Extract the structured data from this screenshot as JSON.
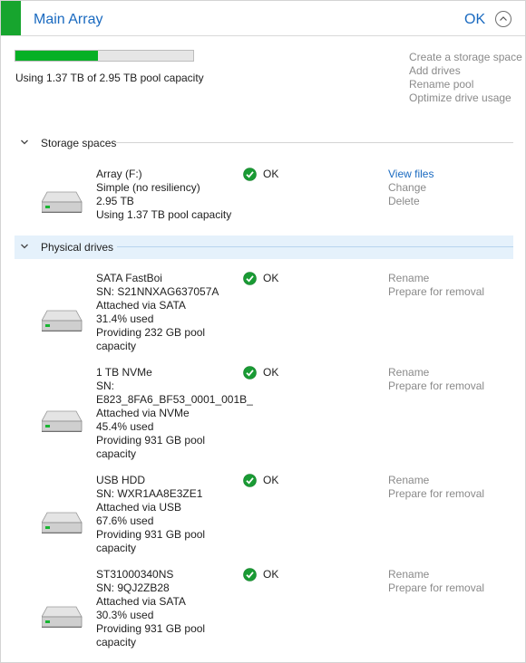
{
  "pool": {
    "title": "Main Array",
    "status": "OK",
    "usage_fraction": 0.464,
    "usage_text": "Using 1.37 TB of 2.95 TB pool capacity",
    "actions": [
      "Create a storage space",
      "Add drives",
      "Rename pool",
      "Optimize drive usage"
    ],
    "accent": "#17a52e",
    "bar_color": "#06b025"
  },
  "storage_spaces": {
    "label": "Storage spaces",
    "items": [
      {
        "lines": [
          "Array (F:)",
          "Simple (no resiliency)",
          "2.95 TB",
          "Using 1.37 TB pool capacity"
        ],
        "status": "OK",
        "actions": [
          "View files",
          "Change",
          "Delete"
        ]
      }
    ]
  },
  "physical_drives": {
    "label": "Physical drives",
    "items": [
      {
        "lines": [
          "SATA FastBoi",
          "SN: S21NNXAG637057A",
          "Attached via SATA",
          "31.4% used",
          "Providing 232 GB pool",
          "capacity"
        ],
        "status": "OK",
        "actions": [
          "Rename",
          "Prepare for removal"
        ]
      },
      {
        "lines": [
          "1 TB NVMe",
          "SN:",
          "E823_8FA6_BF53_0001_001B_",
          "Attached via NVMe",
          "45.4% used",
          "Providing 931 GB pool",
          "capacity"
        ],
        "status": "OK",
        "actions": [
          "Rename",
          "Prepare for removal"
        ]
      },
      {
        "lines": [
          "USB HDD",
          "SN: WXR1AA8E3ZE1",
          "Attached via USB",
          "67.6% used",
          "Providing 931 GB pool",
          "capacity"
        ],
        "status": "OK",
        "actions": [
          "Rename",
          "Prepare for removal"
        ]
      },
      {
        "lines": [
          "ST31000340NS",
          "SN: 9QJ2ZB28",
          "Attached via SATA",
          "30.3% used",
          "Providing 931 GB pool",
          "capacity"
        ],
        "status": "OK",
        "actions": [
          "Rename",
          "Prepare for removal"
        ]
      }
    ]
  },
  "icons": {
    "status_ok": "green-check-circle-icon",
    "drive": "hard-drive-icon",
    "collapse": "chevron-up-circle-icon",
    "section": "chevron-down-icon"
  }
}
